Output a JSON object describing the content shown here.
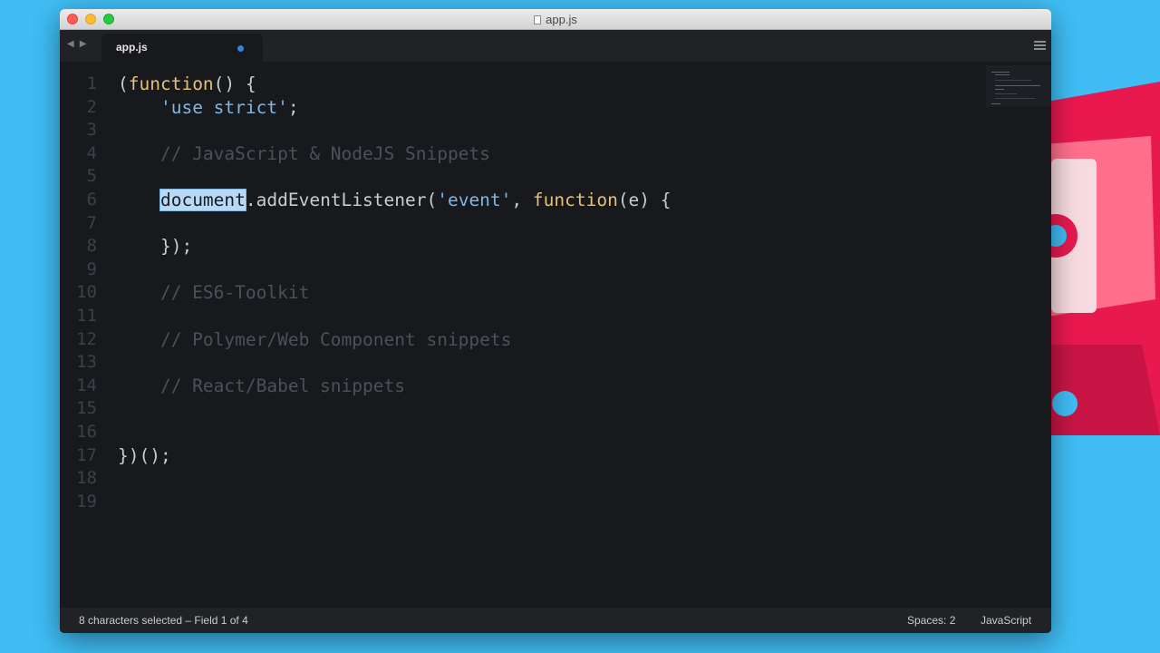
{
  "window": {
    "title": "app.js"
  },
  "tab": {
    "label": "app.js",
    "modified": true
  },
  "editor": {
    "line_numbers": [
      "1",
      "2",
      "3",
      "4",
      "5",
      "6",
      "7",
      "8",
      "9",
      "10",
      "11",
      "12",
      "13",
      "14",
      "15",
      "16",
      "17",
      "18",
      "19"
    ],
    "lines": {
      "l1a": "(",
      "l1b": "function",
      "l1c": "() {",
      "l2a": "    ",
      "l2b": "'use strict'",
      "l2c": ";",
      "l4": "    // JavaScript & NodeJS Snippets",
      "l6a": "    ",
      "l6sel": "document",
      "l6b": ".addEventListener(",
      "l6c": "'event'",
      "l6d": ", ",
      "l6e": "function",
      "l6f": "(e) {",
      "l8": "    });",
      "l10": "    // ES6-Toolkit",
      "l12": "    // Polymer/Web Component snippets",
      "l14": "    // React/Babel snippets",
      "l17": "})();"
    }
  },
  "statusbar": {
    "selection": "8 characters selected – Field 1 of 4",
    "indent": "Spaces: 2",
    "syntax": "JavaScript"
  },
  "colors": {
    "desktop": "#3fbdf4",
    "editor_bg": "#17191d",
    "keyword": "#e4c07b",
    "string": "#7eb6e6",
    "comment": "#4c5058",
    "selection": "#b7d9f5",
    "modified_dot": "#2e86de"
  }
}
